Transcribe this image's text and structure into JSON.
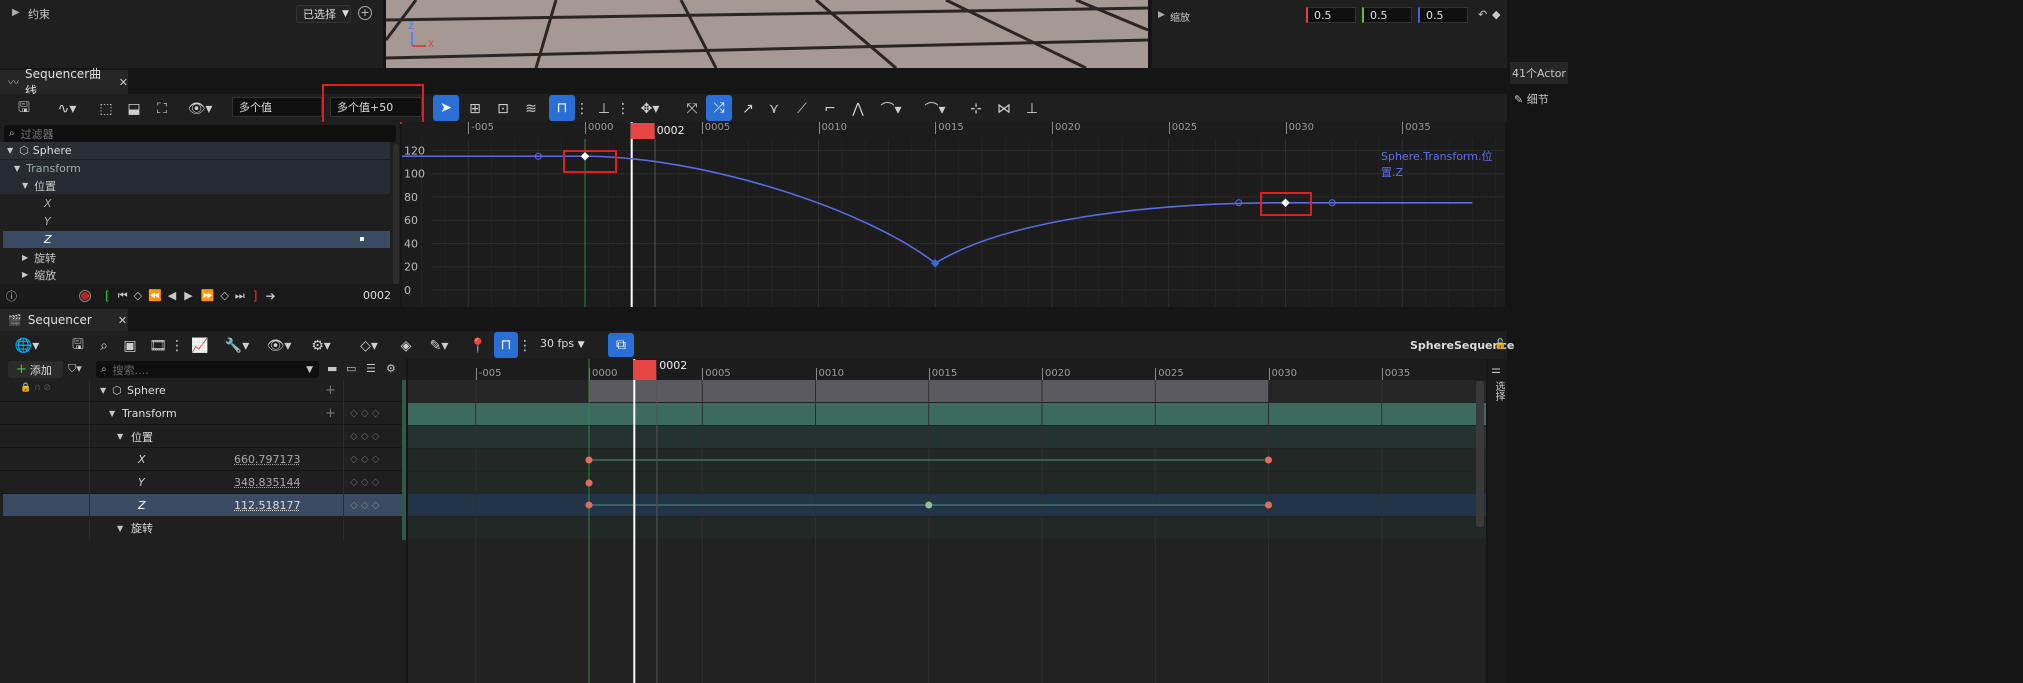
{
  "top": {
    "constraint_label": "约束",
    "constraint_dropdown": "已选择",
    "scale_label": "缩放",
    "scale_values": [
      "0.5",
      "0.5",
      "0.5"
    ],
    "actor_count": "41个Actor",
    "details_label": "细节"
  },
  "curve_panel": {
    "tab_title": "Sequencer曲线",
    "value_field": "多个值",
    "value_field2": "多个值+50",
    "filter_placeholder": "过滤器",
    "tree": [
      "Sphere",
      "Transform",
      "位置",
      "X",
      "Y",
      "Z",
      "旋转",
      "缩放"
    ],
    "current_frame": "0002",
    "curve_label": "Sphere.Transform.位置.Z",
    "ticks": [
      "-005",
      "0000",
      "0005",
      "0010",
      "0015",
      "0020",
      "0025",
      "0030",
      "0035"
    ],
    "y_ticks": [
      "120",
      "100",
      "80",
      "60",
      "40",
      "20",
      "0"
    ],
    "playhead": "0002"
  },
  "sequencer": {
    "tab_title": "Sequencer",
    "fps": "30 fps",
    "sequence_name": "SphereSequence",
    "add_label": "添加",
    "search_placeholder": "搜索....",
    "tracks": [
      "Sphere",
      "Transform",
      "位置",
      "X",
      "Y",
      "Z",
      "旋转"
    ],
    "values": {
      "x": "660.797173",
      "y": "348.835144",
      "z": "112.518177"
    },
    "ticks": [
      "-005",
      "0000",
      "0005",
      "0010",
      "0015",
      "0020",
      "0025",
      "0030",
      "0035"
    ],
    "playhead": "0002",
    "side_label": "选择"
  },
  "chart_data": {
    "type": "line",
    "title": "",
    "series": [
      {
        "name": "Sphere.Transform.位置.Z",
        "points": [
          [
            -8,
            115
          ],
          [
            0,
            115
          ],
          [
            15,
            23
          ],
          [
            30,
            75
          ],
          [
            38,
            75
          ]
        ]
      }
    ],
    "keys": [
      [
        0,
        115
      ],
      [
        15,
        23
      ],
      [
        30,
        75
      ]
    ],
    "xlim": [
      -8,
      38
    ],
    "ylim": [
      -5,
      127
    ]
  }
}
